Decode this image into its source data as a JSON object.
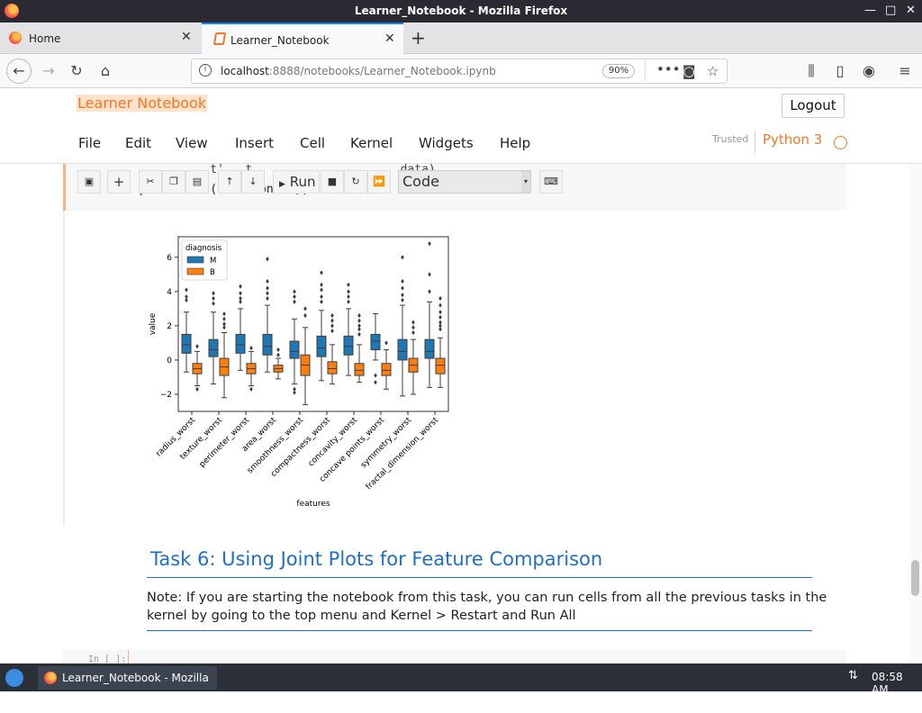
{
  "window": {
    "title": "Learner_Notebook - Mozilla Firefox"
  },
  "tabs": [
    {
      "label": "Home"
    },
    {
      "label": "Learner_Notebook"
    }
  ],
  "urlbar": {
    "host": "localhost",
    "path": ":8888/notebooks/Learner_Notebook.ipynb",
    "zoom": "90%"
  },
  "jupyter": {
    "logo": "Learner Notebook",
    "logout": "Logout",
    "menu": [
      "File",
      "Edit",
      "View",
      "Insert",
      "Cell",
      "Kernel",
      "Widgets",
      "Help"
    ],
    "trusted": "Trusted",
    "kernel": "Python 3"
  },
  "cell": {
    "code_line1": "          t'   t               ,     data)",
    "code_line2": "plt.xticks(rotation=45);",
    "run_label": "Run",
    "cell_type": "Code"
  },
  "markdown": {
    "heading": "Task 6: Using Joint Plots for Feature Comparison",
    "note": "Note: If you are starting the notebook from this task, you can run cells from all the previous tasks in the kernel by going to the top menu and Kernel > Restart and Run All"
  },
  "next_cell": {
    "prompt": "In [ ]:"
  },
  "taskbar": {
    "task": "Learner_Notebook - Mozilla ...",
    "clock": "08:58 AM"
  },
  "chart_data": {
    "type": "box",
    "xlabel": "features",
    "ylabel": "value",
    "ylim": [
      -3,
      7.2
    ],
    "yticks": [
      -2,
      0,
      2,
      4,
      6
    ],
    "legend": {
      "title": "diagnosis",
      "position": "top-left",
      "entries": [
        "M",
        "B"
      ]
    },
    "colors": {
      "M": "#1f77b4",
      "B": "#ff7f0e"
    },
    "categories": [
      "radius_worst",
      "texture_worst",
      "perimeter_worst",
      "area_worst",
      "smoothness_worst",
      "compactness_worst",
      "concavity_worst",
      "concave points_worst",
      "symmetry_worst",
      "fractal_dimension_worst"
    ],
    "series": [
      {
        "name": "M",
        "boxes": [
          {
            "q1": 0.4,
            "median": 0.9,
            "q3": 1.5,
            "whislo": -0.7,
            "whishi": 2.8,
            "outliers": [
              4.1,
              3.7,
              3.5
            ]
          },
          {
            "q1": 0.2,
            "median": 0.6,
            "q3": 1.2,
            "whislo": -1.4,
            "whishi": 2.8,
            "outliers": [
              3.9,
              3.6,
              3.3
            ]
          },
          {
            "q1": 0.4,
            "median": 0.9,
            "q3": 1.5,
            "whislo": -0.6,
            "whishi": 3.0,
            "outliers": [
              4.3,
              3.9,
              3.6,
              3.4
            ]
          },
          {
            "q1": 0.3,
            "median": 0.8,
            "q3": 1.5,
            "whislo": -0.7,
            "whishi": 3.2,
            "outliers": [
              5.9,
              4.6,
              4.2,
              3.9,
              3.6
            ]
          },
          {
            "q1": 0.1,
            "median": 0.5,
            "q3": 1.1,
            "whislo": -1.4,
            "whishi": 2.4,
            "outliers": [
              4.0,
              3.7,
              3.4,
              -1.7,
              -1.9
            ]
          },
          {
            "q1": 0.2,
            "median": 0.7,
            "q3": 1.4,
            "whislo": -1.2,
            "whishi": 2.9,
            "outliers": [
              5.1,
              4.4,
              4.1,
              3.7,
              3.4
            ]
          },
          {
            "q1": 0.3,
            "median": 0.8,
            "q3": 1.4,
            "whislo": -0.9,
            "whishi": 3.0,
            "outliers": [
              4.4,
              4.0,
              3.7,
              3.4
            ]
          },
          {
            "q1": 0.6,
            "median": 1.1,
            "q3": 1.5,
            "whislo": 0.0,
            "whishi": 2.7,
            "outliers": [
              -1.3,
              -0.9
            ]
          },
          {
            "q1": 0.0,
            "median": 0.5,
            "q3": 1.2,
            "whislo": -2.1,
            "whishi": 3.2,
            "outliers": [
              6.0,
              4.6,
              4.2,
              3.8,
              3.5
            ]
          },
          {
            "q1": 0.1,
            "median": 0.5,
            "q3": 1.2,
            "whislo": -1.6,
            "whishi": 3.4,
            "outliers": [
              6.8,
              5.0,
              4.0
            ]
          }
        ]
      },
      {
        "name": "B",
        "boxes": [
          {
            "q1": -0.8,
            "median": -0.5,
            "q3": -0.2,
            "whislo": -1.5,
            "whishi": 0.5,
            "outliers": [
              0.8,
              -1.7
            ]
          },
          {
            "q1": -0.9,
            "median": -0.4,
            "q3": 0.1,
            "whislo": -2.2,
            "whishi": 1.6,
            "outliers": [
              2.7,
              2.4,
              2.1,
              1.9
            ]
          },
          {
            "q1": -0.8,
            "median": -0.5,
            "q3": -0.2,
            "whislo": -1.5,
            "whishi": 0.5,
            "outliers": [
              0.7,
              -1.7
            ]
          },
          {
            "q1": -0.7,
            "median": -0.5,
            "q3": -0.3,
            "whislo": -1.1,
            "whishi": 0.1,
            "outliers": [
              0.6,
              0.3
            ]
          },
          {
            "q1": -0.9,
            "median": -0.3,
            "q3": 0.3,
            "whislo": -2.6,
            "whishi": 1.9,
            "outliers": [
              3.0,
              2.6
            ]
          },
          {
            "q1": -0.8,
            "median": -0.5,
            "q3": -0.1,
            "whislo": -1.4,
            "whishi": 0.9,
            "outliers": [
              2.6,
              2.3,
              2.0,
              1.7
            ]
          },
          {
            "q1": -0.9,
            "median": -0.6,
            "q3": -0.2,
            "whislo": -1.3,
            "whishi": 0.9,
            "outliers": [
              2.6,
              2.3,
              2.0,
              1.8,
              1.5
            ]
          },
          {
            "q1": -0.9,
            "median": -0.6,
            "q3": -0.2,
            "whislo": -1.7,
            "whishi": 0.6,
            "outliers": [
              1.0
            ]
          },
          {
            "q1": -0.7,
            "median": -0.3,
            "q3": 0.1,
            "whislo": -2.0,
            "whishi": 1.2,
            "outliers": [
              2.2,
              1.9,
              1.6
            ]
          },
          {
            "q1": -0.8,
            "median": -0.3,
            "q3": 0.1,
            "whislo": -1.6,
            "whishi": 1.3,
            "outliers": [
              3.6,
              3.2,
              2.8,
              2.5,
              2.2,
              2.0,
              1.8
            ]
          }
        ]
      }
    ]
  }
}
